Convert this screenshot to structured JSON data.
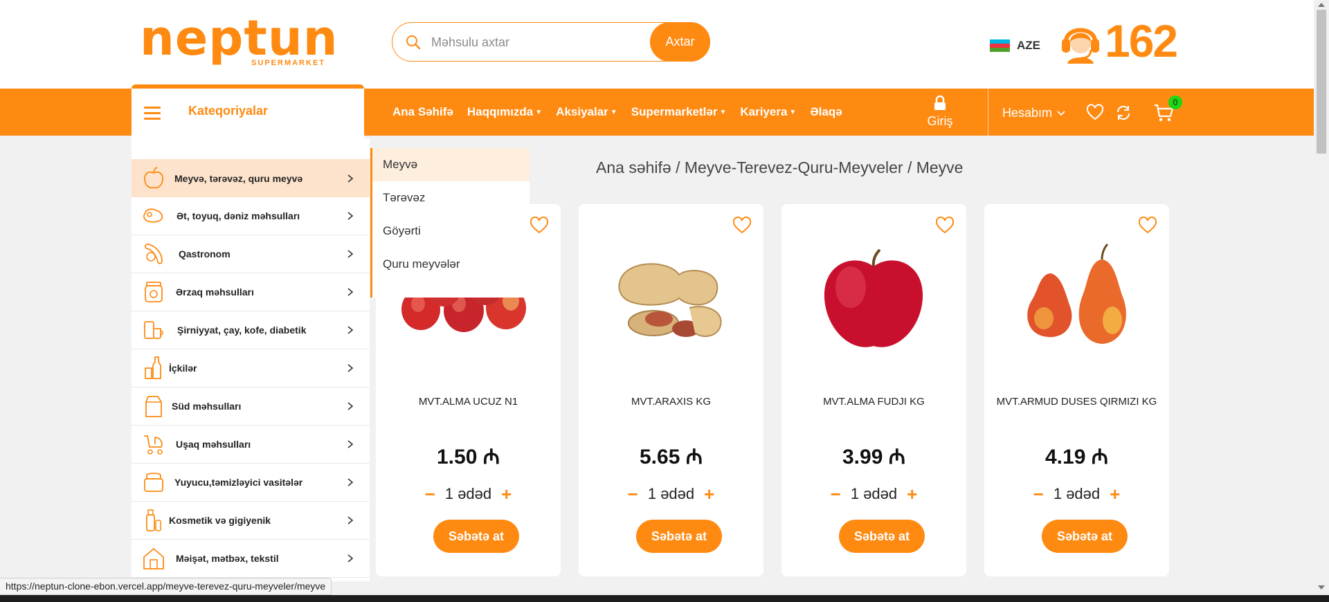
{
  "header": {
    "logo_text": "neptun",
    "logo_subtitle": "SUPERMARKET",
    "search_placeholder": "Məhsulu axtar",
    "search_button": "Axtar",
    "language": "AZE",
    "hotline": "162",
    "colors": {
      "brand": "#fe8a12",
      "badge": "#1ed615"
    }
  },
  "nav": {
    "categories_label": "Kateqoriyalar",
    "links": [
      {
        "label": "Ana Səhifə",
        "dropdown": false
      },
      {
        "label": "Haqqımızda",
        "dropdown": true
      },
      {
        "label": "Aksiyalar",
        "dropdown": true
      },
      {
        "label": "Supermarketlər",
        "dropdown": true
      },
      {
        "label": "Kariyera",
        "dropdown": true
      },
      {
        "label": "Əlaqə",
        "dropdown": false
      }
    ],
    "login_label": "Giriş",
    "account_label": "Hesabım",
    "cart_count": "0"
  },
  "sidebar": {
    "items": [
      {
        "label": "Meyvə, tərəvəz, quru meyvə",
        "icon": "apple-icon"
      },
      {
        "label": "Ət, toyuq, dəniz məhsulları",
        "icon": "meat-icon"
      },
      {
        "label": "Qastronom",
        "icon": "sausage-icon"
      },
      {
        "label": "Ərzaq məhsulları",
        "icon": "jar-icon"
      },
      {
        "label": "Şirniyyat, çay, kofe, diabetik",
        "icon": "coffee-icon"
      },
      {
        "label": "İçkilər",
        "icon": "bottle-icon"
      },
      {
        "label": "Süd məhsulları",
        "icon": "milk-carton-icon"
      },
      {
        "label": "Uşaq məhsulları",
        "icon": "stroller-icon"
      },
      {
        "label": "Yuyucu,təmizləyici vasitələr",
        "icon": "detergent-icon"
      },
      {
        "label": "Kosmetik və gigiyenik",
        "icon": "cosmetics-icon"
      },
      {
        "label": "Məişət, mətbəx, tekstil",
        "icon": "house-icon"
      }
    ]
  },
  "submenu": {
    "items": [
      "Meyvə",
      "Tərəvəz",
      "Göyərti",
      "Quru meyvələr"
    ]
  },
  "breadcrumb": "Ana səhifə / Meyve-Terevez-Quru-Meyveler / Meyve",
  "products": [
    {
      "name": "MVT.ALMA UCUZ N1",
      "price": "1.50 ₼",
      "quantity": "1 ədəd",
      "button": "Səbətə at",
      "image": "apples-image"
    },
    {
      "name": "MVT.ARAXIS KG",
      "price": "5.65 ₼",
      "quantity": "1 ədəd",
      "button": "Səbətə at",
      "image": "peanuts-image"
    },
    {
      "name": "MVT.ALMA FUDJI KG",
      "price": "3.99 ₼",
      "quantity": "1 ədəd",
      "button": "Səbətə at",
      "image": "red-apple-image"
    },
    {
      "name": "MVT.ARMUD DUSES QIRMIZI KG",
      "price": "4.19 ₼",
      "quantity": "1 ədəd",
      "button": "Səbətə at",
      "image": "pears-image"
    }
  ],
  "status_bar": {
    "url": "https://neptun-clone-ebon.vercel.app/meyve-terevez-quru-meyveler/meyve"
  }
}
